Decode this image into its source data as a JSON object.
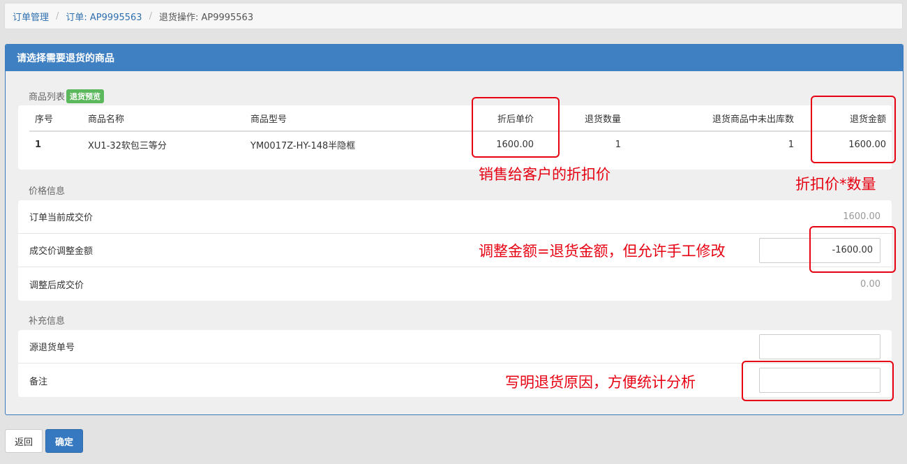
{
  "breadcrumb": {
    "item1": "订单管理",
    "item2": "订单: AP9995563",
    "current": "退货操作: AP9995563"
  },
  "panel": {
    "title": "请选择需要退货的商品"
  },
  "goods": {
    "label": "商品列表",
    "badge": "退货预览",
    "columns": [
      "序号",
      "商品名称",
      "商品型号",
      "折后单价",
      "退货数量",
      "退货商品中未出库数",
      "退货金额"
    ],
    "rows": [
      [
        "1",
        "XU1-32软包三等分",
        "YM0017Z-HY-148半隐框",
        "1600.00",
        "1",
        "1",
        "1600.00"
      ]
    ]
  },
  "price": {
    "label": "价格信息",
    "current_label": "订单当前成交价",
    "current_value": "1600.00",
    "adjust_label": "成交价调整金额",
    "adjust_value": "-1600.00",
    "after_label": "调整后成交价",
    "after_value": "0.00"
  },
  "extra": {
    "label": "补充信息",
    "source_label": "源退货单号",
    "source_value": "",
    "remark_label": "备注",
    "remark_value": ""
  },
  "buttons": {
    "back": "返回",
    "confirm": "确定"
  },
  "annotations": {
    "discount_price": "销售给客户的折扣价",
    "amount_formula": "折扣价*数量",
    "adjust_note": "调整金额=退货金额，但允许手工修改",
    "remark_note": "写明退货原因，方便统计分析",
    "color": "#e60012"
  }
}
